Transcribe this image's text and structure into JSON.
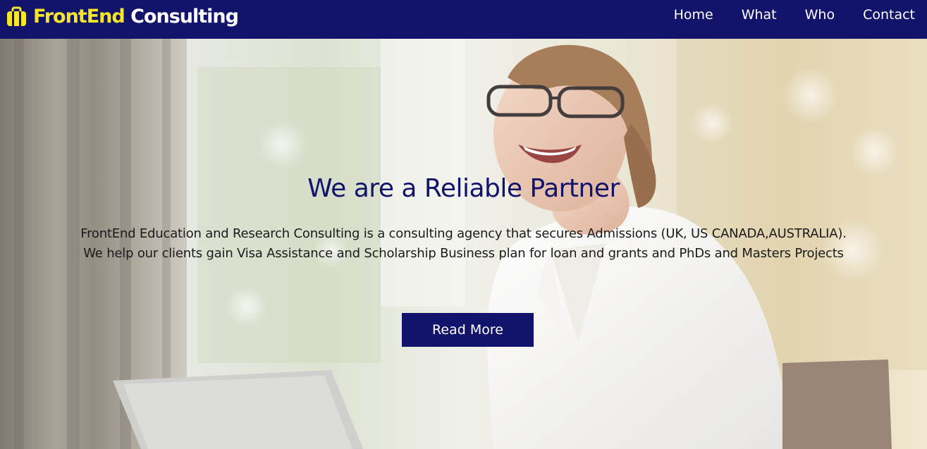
{
  "navbar": {
    "brand_part1": "FrontEnd",
    "brand_part2": "Consulting",
    "brand_icon": "briefcase-icon",
    "links": [
      {
        "label": "Home"
      },
      {
        "label": "What"
      },
      {
        "label": "Who"
      },
      {
        "label": "Contact"
      }
    ]
  },
  "hero": {
    "title": "We are a Reliable Partner",
    "description_line1": "FrontEnd Education and Research Consulting is a consulting agency that secures Admissions (UK, US CANADA,AUSTRALIA).",
    "description_line2": "We help our clients gain Visa Assistance and Scholarship Business plan for loan and grants and PhDs and Masters Projects",
    "button_label": "Read More"
  },
  "colors": {
    "navbar_bg": "#12136a",
    "brand_accent": "#f5e627",
    "title_color": "#12136a",
    "button_bg": "#12136a"
  }
}
